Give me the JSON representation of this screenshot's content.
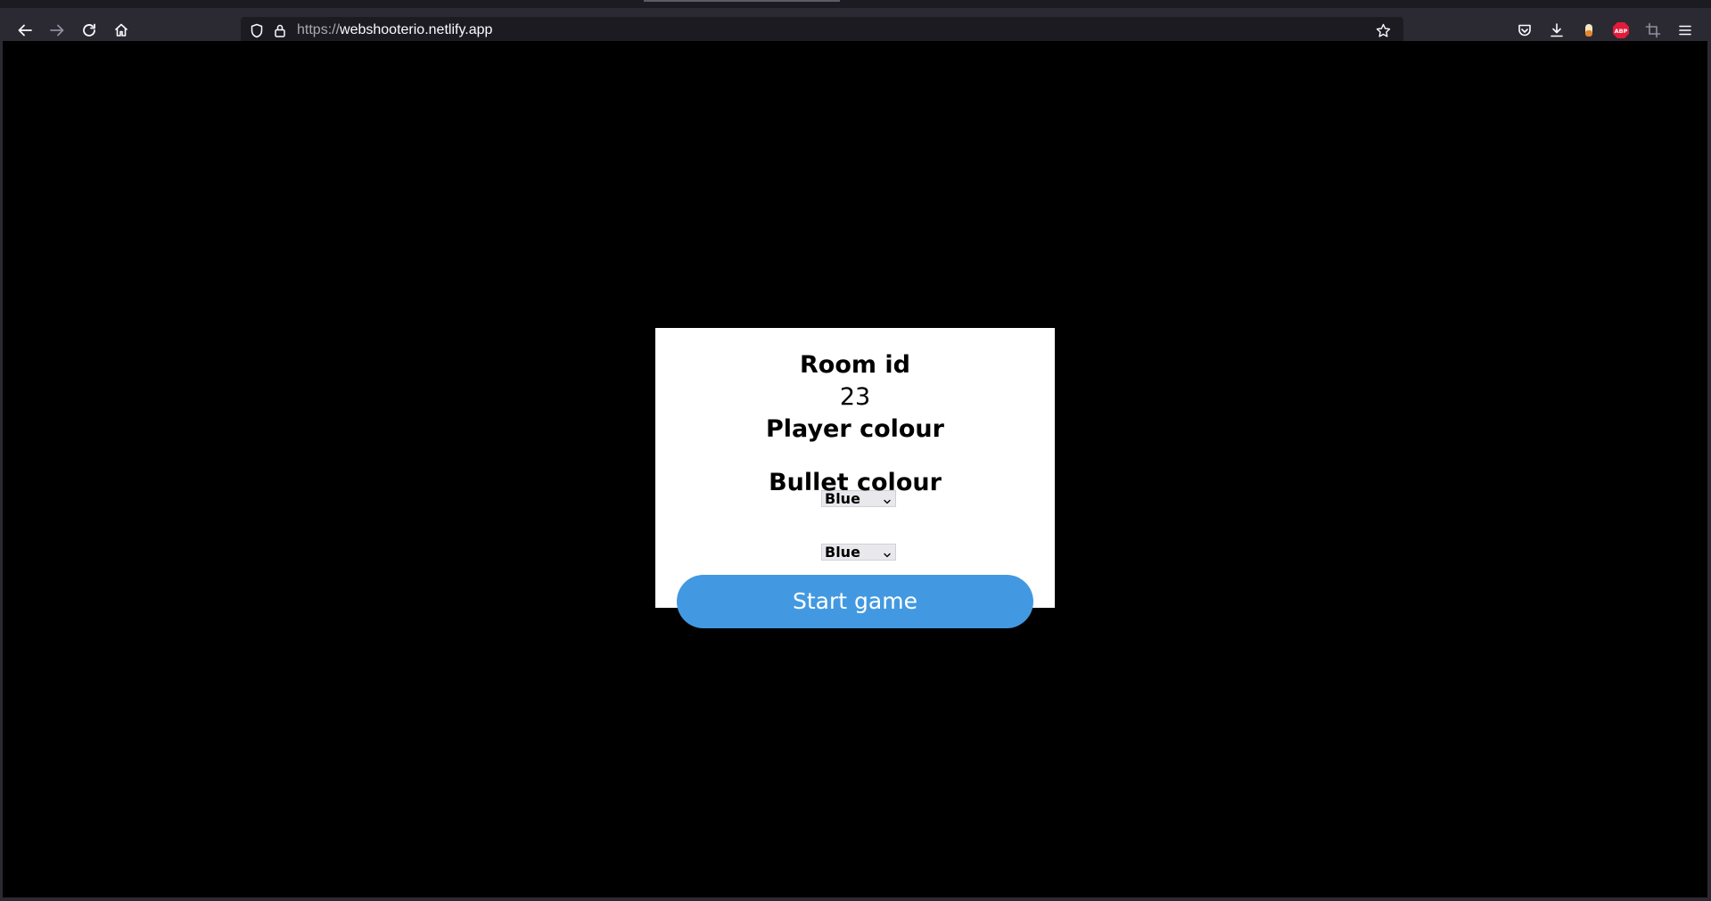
{
  "browser": {
    "url_protocol": "https://",
    "url_host": "webshooterio.netlify.app",
    "icons": {
      "back": "back-arrow-icon",
      "forward": "forward-arrow-icon",
      "reload": "reload-icon",
      "home": "home-icon",
      "shield": "tracking-shield-icon",
      "lock": "lock-icon",
      "bookmark": "star-icon",
      "pocket": "pocket-icon",
      "downloads": "download-icon",
      "extension1": "extension-icon",
      "adblock": "adblock-icon",
      "screenshot": "crop-icon",
      "menu": "hamburger-menu-icon"
    },
    "adblock_label": "ABP"
  },
  "game": {
    "room_label": "Room id",
    "room_value": "23",
    "player_colour_label": "Player colour",
    "player_colour_value": "Blue",
    "bullet_colour_label": "Bullet colour",
    "bullet_colour_value": "Blue",
    "start_button_label": "Start game",
    "colors": {
      "background": "#000000",
      "dialog": "#ffffff",
      "button": "#4299e1"
    }
  }
}
